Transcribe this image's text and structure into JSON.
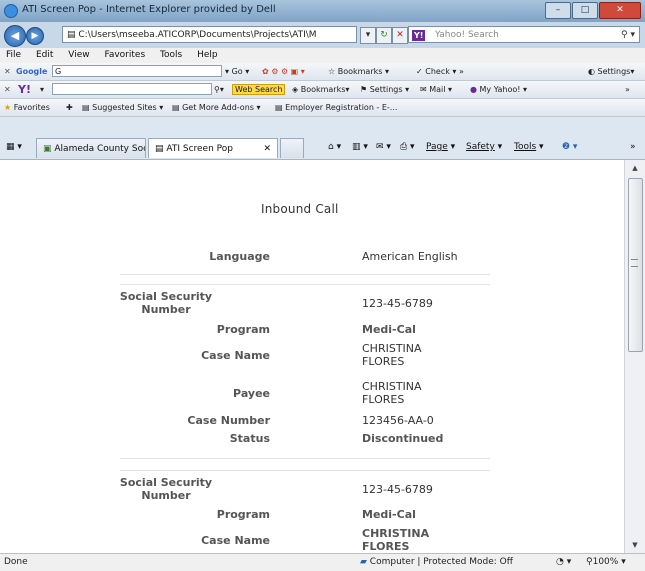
{
  "window": {
    "title": "ATI Screen Pop - Internet Explorer provided by Dell"
  },
  "address": {
    "url": "C:\\Users\\mseeba.ATICORP\\Documents\\Projects\\ATI\\M",
    "search_placeholder": "Yahoo! Search"
  },
  "menu": [
    "File",
    "Edit",
    "View",
    "Favorites",
    "Tools",
    "Help"
  ],
  "google_bar": {
    "label": "Google",
    "field": "G",
    "go": "Go",
    "bookmarks": "Bookmarks",
    "check": "Check",
    "settings": "Settings"
  },
  "yahoo_bar": {
    "web_search": "Web Search",
    "bookmarks": "Bookmarks",
    "settings": "Settings",
    "mail": "Mail",
    "my_yahoo": "My Yahoo!"
  },
  "favorites_bar": {
    "favorites": "Favorites",
    "suggested": "Suggested Sites",
    "get_more": "Get More Add-ons",
    "employer": "Employer Registration - E-..."
  },
  "tabs": [
    {
      "label": "Alameda County Social..."
    },
    {
      "label": "ATI Screen Pop"
    }
  ],
  "tab_tools": {
    "page": "Page",
    "safety": "Safety",
    "tools": "Tools"
  },
  "page": {
    "heading": "Inbound Call",
    "rows": [
      {
        "label": "Language",
        "value": "American English"
      },
      {
        "label": "Social Security Number",
        "value": "123-45-6789"
      },
      {
        "label": "Program",
        "value": "Medi-Cal"
      },
      {
        "label": "Case Name",
        "value": "CHRISTINA FLORES"
      },
      {
        "label": "Payee",
        "value": "CHRISTINA FLORES"
      },
      {
        "label": "Case Number",
        "value": "123456-AA-0"
      },
      {
        "label": "Status",
        "value": "Discontinued"
      },
      {
        "label": "Social Security Number",
        "value": "123-45-6789"
      },
      {
        "label": "Program",
        "value": "Medi-Cal"
      },
      {
        "label": "Case Name",
        "value": "CHRISTINA FLORES"
      }
    ]
  },
  "status": {
    "left": "Done",
    "zone": "Computer | Protected Mode: Off",
    "zoom": "100%"
  }
}
